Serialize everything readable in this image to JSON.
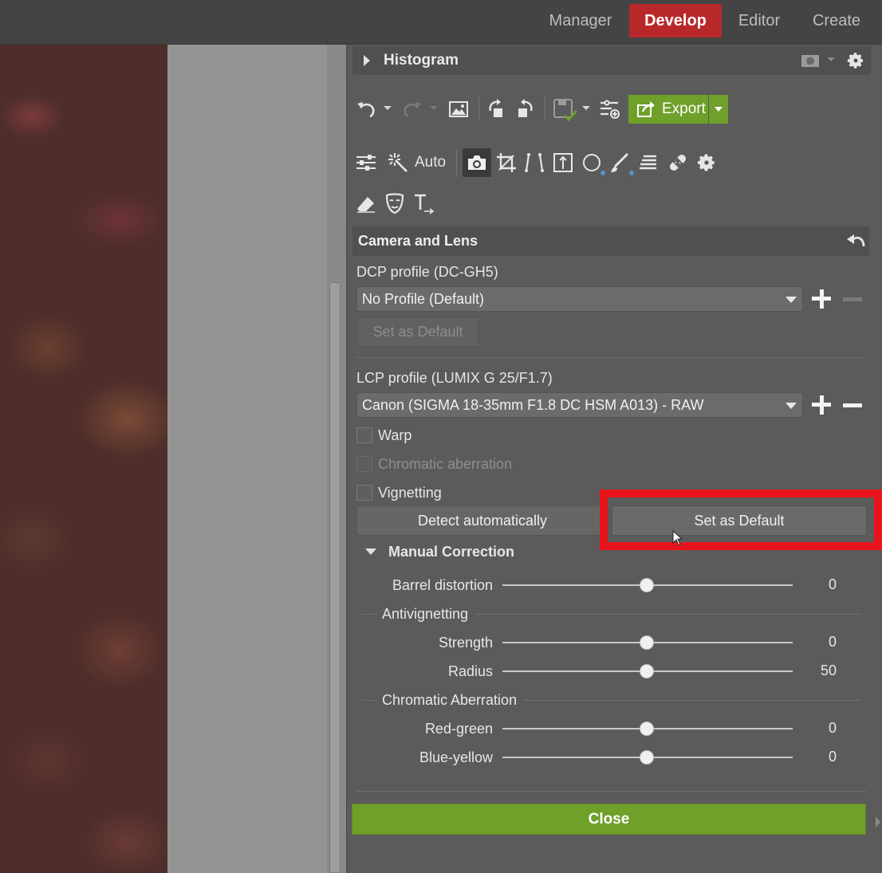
{
  "topbar": {
    "tabs": [
      {
        "label": "Manager",
        "active": false
      },
      {
        "label": "Develop",
        "active": true
      },
      {
        "label": "Editor",
        "active": false
      },
      {
        "label": "Create",
        "active": false
      }
    ]
  },
  "histogram": {
    "label": "Histogram"
  },
  "toolbar": {
    "export_label": "Export",
    "auto_label": "Auto"
  },
  "camera_lens": {
    "title": "Camera and Lens",
    "dcp_label": "DCP profile (DC-GH5)",
    "dcp_value": "No Profile (Default)",
    "dcp_set_default": "Set as Default",
    "lcp_label": "LCP profile (LUMIX G 25/F1.7)",
    "lcp_value": "Canon (SIGMA 18-35mm F1.8 DC HSM A013) - RAW",
    "checkboxes": [
      {
        "label": "Warp",
        "enabled": true,
        "checked": false
      },
      {
        "label": "Chromatic aberration",
        "enabled": false,
        "checked": false
      },
      {
        "label": "Vignetting",
        "enabled": true,
        "checked": false
      }
    ],
    "detect_button": "Detect automatically",
    "set_default_button": "Set as Default"
  },
  "manual_correction": {
    "title": "Manual Correction",
    "barrel": {
      "label": "Barrel distortion",
      "value": "0",
      "min": -100,
      "max": 100,
      "current": 0
    },
    "antivignetting_group": "Antivignetting",
    "strength": {
      "label": "Strength",
      "value": "0",
      "min": -100,
      "max": 100,
      "current": 0
    },
    "radius": {
      "label": "Radius",
      "value": "50",
      "min": 0,
      "max": 100,
      "current": 50
    },
    "chromatic_group": "Chromatic Aberration",
    "red_green": {
      "label": "Red-green",
      "value": "0",
      "min": -100,
      "max": 100,
      "current": 0
    },
    "blue_yellow": {
      "label": "Blue-yellow",
      "value": "0",
      "min": -100,
      "max": 100,
      "current": 0
    }
  },
  "close_label": "Close",
  "colors": {
    "accent_green": "#6fa02a",
    "develop_red": "#b8282a",
    "highlight_red": "#e8141b"
  }
}
